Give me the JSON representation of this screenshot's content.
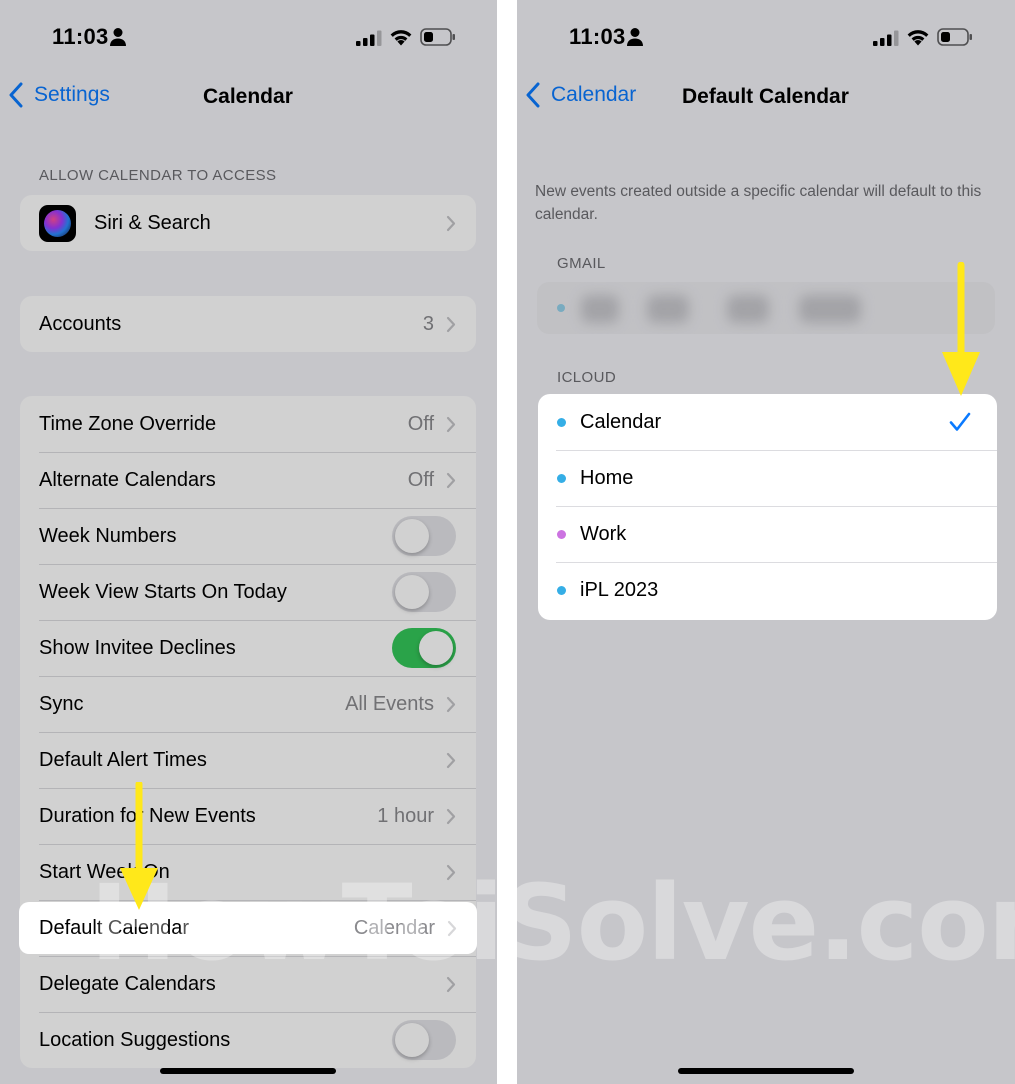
{
  "left": {
    "status": {
      "time": "11:03"
    },
    "nav": {
      "back_label": "Settings",
      "title": "Calendar"
    },
    "allow_header": "ALLOW CALENDAR TO ACCESS",
    "siri_label": "Siri & Search",
    "accounts": {
      "label": "Accounts",
      "value": "3"
    },
    "rows": [
      {
        "label": "Time Zone Override",
        "value": "Off"
      },
      {
        "label": "Alternate Calendars",
        "value": "Off"
      },
      {
        "label": "Week Numbers",
        "toggle": false
      },
      {
        "label": "Week View Starts On Today",
        "toggle": false
      },
      {
        "label": "Show Invitee Declines",
        "toggle": true
      },
      {
        "label": "Sync",
        "value": "All Events"
      },
      {
        "label": "Default Alert Times",
        "value": ""
      },
      {
        "label": "Duration for New Events",
        "value": "1 hour"
      },
      {
        "label": "Start Week On",
        "value": ""
      },
      {
        "label": "Default Calendar",
        "value": "Calendar"
      },
      {
        "label": "Delegate Calendars",
        "value": ""
      },
      {
        "label": "Location Suggestions",
        "toggle": false
      }
    ]
  },
  "right": {
    "status": {
      "time": "11:03"
    },
    "nav": {
      "back_label": "Calendar",
      "title": "Default Calendar"
    },
    "description": "New events created outside a specific calendar will default to this calendar.",
    "gmail_header": "GMAIL",
    "icloud_header": "ICLOUD",
    "calendars": [
      {
        "label": "Calendar",
        "color": "#35aee6",
        "selected": true
      },
      {
        "label": "Home",
        "color": "#35aee6",
        "selected": false
      },
      {
        "label": "Work",
        "color": "#cc73e1",
        "selected": false
      },
      {
        "label": "iPL 2023",
        "color": "#35aee6",
        "selected": false
      }
    ]
  },
  "colors": {
    "accent": "#0a7aff",
    "toggle_on": "#34c759",
    "arrow": "#ffe81a"
  },
  "watermark": "HowToiSolve.com"
}
